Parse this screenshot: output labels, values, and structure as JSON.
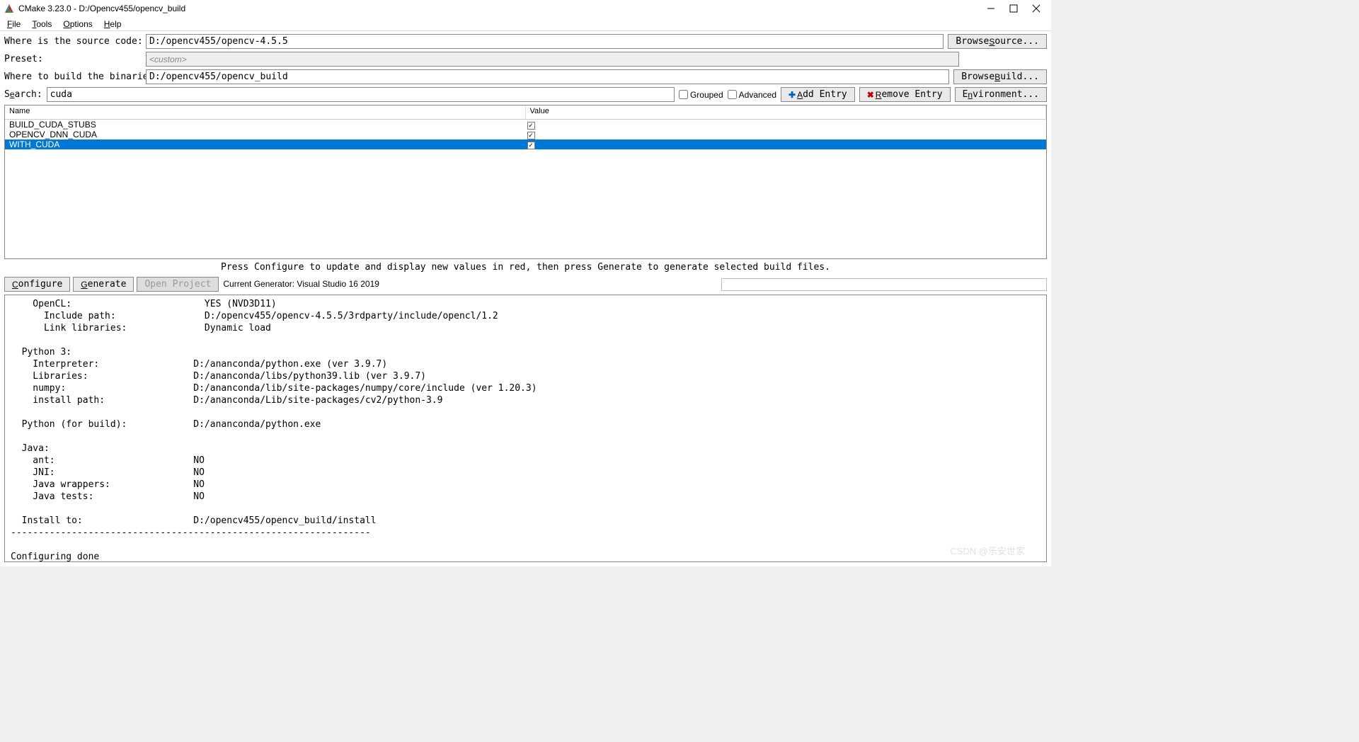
{
  "title": "CMake 3.23.0 - D:/Opencv455/opencv_build",
  "menu": {
    "file": "File",
    "tools": "Tools",
    "options": "Options",
    "help": "Help"
  },
  "labels": {
    "source": "Where is the source code:",
    "preset": "Preset:",
    "build": "Where to build the binaries:",
    "search": "Search:",
    "grouped": "Grouped",
    "advanced": "Advanced",
    "add_entry": "Add Entry",
    "remove_entry": "Remove Entry",
    "environment": "Environment...",
    "browse_source": "Browse Source...",
    "browse_build": "Browse Build...",
    "configure": "Configure",
    "generate": "Generate",
    "open_project": "Open Project",
    "curgen_prefix": "Current Generator: "
  },
  "fields": {
    "source_path": "D:/opencv455/opencv-4.5.5",
    "preset_placeholder": "<custom>",
    "build_path": "D:/opencv455/opencv_build",
    "search_value": "cuda",
    "curgen": "Visual Studio 16 2019"
  },
  "grid": {
    "headers": {
      "name": "Name",
      "value": "Value"
    },
    "rows": [
      {
        "name": "BUILD_CUDA_STUBS",
        "checked": true,
        "selected": false
      },
      {
        "name": "OPENCV_DNN_CUDA",
        "checked": true,
        "selected": false
      },
      {
        "name": "WITH_CUDA",
        "checked": true,
        "selected": true
      }
    ]
  },
  "hint": "Press Configure to update and display new values in red, then press Generate to generate selected build files.",
  "output_lines": [
    "    OpenCL:                        YES (NVD3D11)",
    "      Include path:                D:/opencv455/opencv-4.5.5/3rdparty/include/opencl/1.2",
    "      Link libraries:              Dynamic load",
    "",
    "  Python 3:",
    "    Interpreter:                 D:/ananconda/python.exe (ver 3.9.7)",
    "    Libraries:                   D:/ananconda/libs/python39.lib (ver 3.9.7)",
    "    numpy:                       D:/ananconda/lib/site-packages/numpy/core/include (ver 1.20.3)",
    "    install path:                D:/ananconda/Lib/site-packages/cv2/python-3.9",
    "",
    "  Python (for build):            D:/ananconda/python.exe",
    "",
    "  Java:",
    "    ant:                         NO",
    "    JNI:                         NO",
    "    Java wrappers:               NO",
    "    Java tests:                  NO",
    "",
    "  Install to:                    D:/opencv455/opencv_build/install",
    "-----------------------------------------------------------------",
    "",
    "Configuring done"
  ],
  "watermark": "CSDN @乐安世家"
}
